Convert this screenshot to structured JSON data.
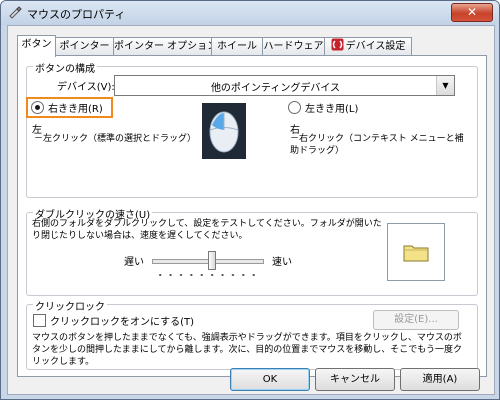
{
  "window": {
    "title": "マウスのプロパティ",
    "close_glyph": "✕"
  },
  "tabs": [
    {
      "label": "ボタン",
      "active": true
    },
    {
      "label": "ポインター"
    },
    {
      "label": "ポインター オプション"
    },
    {
      "label": "ホイール"
    },
    {
      "label": "ハードウェア"
    },
    {
      "label": "デバイス設定"
    }
  ],
  "button_config": {
    "group_label": "ボタンの構成",
    "device_label": "デバイス(V):",
    "device_value": "他のポインティングデバイス",
    "right_handed_label": "右きき用(R)",
    "left_handed_label": "左きき用(L)",
    "left_title": "左",
    "left_desc": "－左クリック（標準の選択とドラッグ）",
    "right_title": "右",
    "right_desc": "－右クリック（コンテキスト メニューと補助ドラッグ）"
  },
  "double_click": {
    "group_label": "ダブルクリックの速さ(U)",
    "description": "右側のフォルダをダブルクリックして、設定をテストしてください。フォルダが開いたり閉じたりしない場合は、速度を遅くしてください。",
    "slow_label": "遅い",
    "fast_label": "速い",
    "speed_level": 0.55
  },
  "click_lock": {
    "group_label": "クリックロック",
    "checkbox_label": "クリックロックをオンにする(T)",
    "settings_button": "設定(E)...",
    "description": "マウスのボタンを押したままでなくても、強調表示やドラッグができます。項目をクリックし、マウスのボタンを少しの間押したままにしてから離します。次に、目的の位置までマウスを移動し、そこでもう一度クリックします。"
  },
  "footer": {
    "ok_label": "OK",
    "cancel_label": "キャンセル",
    "apply_label": "適用(A)"
  },
  "colors": {
    "highlight": "#f08a1c",
    "close_button": "#c7432b"
  },
  "icons": [
    "mouse-properties-icon",
    "close-icon",
    "device-settings-icon",
    "combo-arrow-icon",
    "mouse-image-icon",
    "folder-icon"
  ]
}
